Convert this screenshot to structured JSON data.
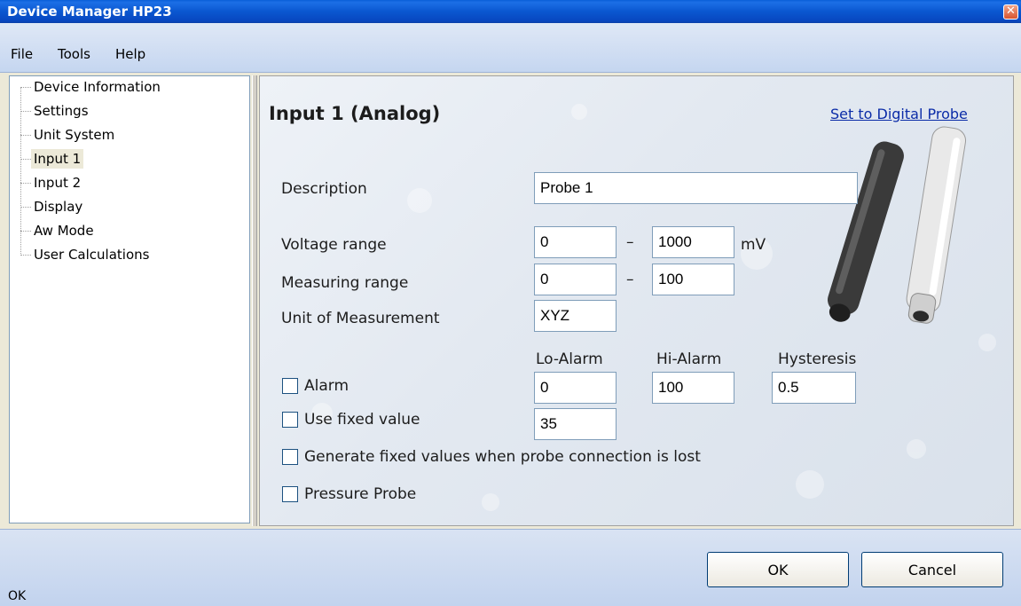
{
  "window": {
    "title": "Device Manager HP23"
  },
  "menu": {
    "items": [
      "File",
      "Tools",
      "Help"
    ]
  },
  "tree": {
    "items": [
      "Device Information",
      "Settings",
      "Unit System",
      "Input 1",
      "Input 2",
      "Display",
      "Aw Mode",
      "User Calculations"
    ],
    "selected": "Input 1"
  },
  "panel": {
    "heading": "Input 1 (Analog)",
    "link": "Set to Digital Probe",
    "description_label": "Description",
    "description_value": "Probe 1",
    "voltage_label": "Voltage range",
    "voltage_min": "0",
    "voltage_max": "1000",
    "voltage_unit": "mV",
    "measuring_label": "Measuring range",
    "measuring_min": "0",
    "measuring_max": "100",
    "dash": "–",
    "unit_label": "Unit of Measurement",
    "unit_value": "XYZ",
    "lo_alarm_label": "Lo-Alarm",
    "hi_alarm_label": "Hi-Alarm",
    "hysteresis_label": "Hysteresis",
    "alarm_label": "Alarm",
    "lo_alarm_value": "0",
    "hi_alarm_value": "100",
    "hysteresis_value": "0.5",
    "fixed_label": "Use fixed value",
    "fixed_value": "35",
    "generate_label": "Generate fixed values when probe connection is lost",
    "pressure_label": "Pressure Probe"
  },
  "buttons": {
    "ok": "OK",
    "cancel": "Cancel"
  },
  "status": {
    "text": "OK"
  },
  "colors": {
    "titlebar": "#0a57d0",
    "link": "#0b2ca8",
    "field_border": "#7f9db9"
  }
}
